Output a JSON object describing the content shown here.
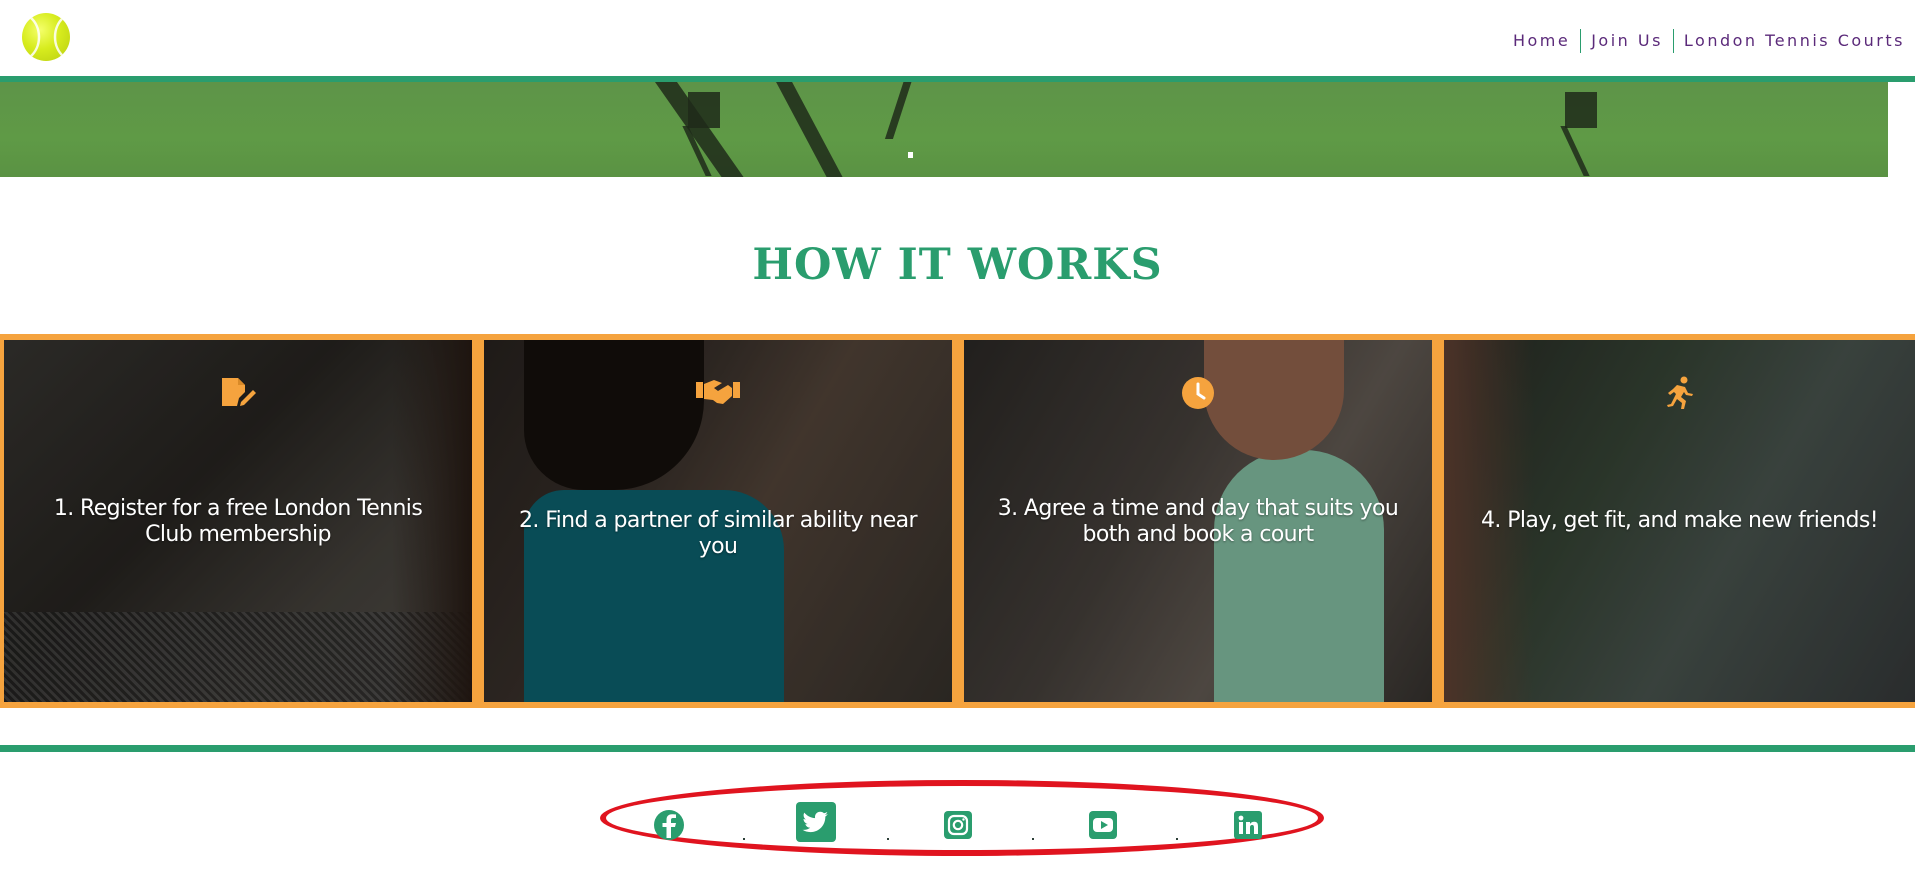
{
  "header": {
    "logo": "tennis-ball-logo",
    "nav": [
      {
        "label": "Home"
      },
      {
        "label": "Join Us"
      },
      {
        "label": "London Tennis Courts"
      }
    ]
  },
  "section": {
    "title": "HOW IT WORKS"
  },
  "steps": [
    {
      "icon": "file-signature-icon",
      "text": "1. Register for a free London Tennis Club membership"
    },
    {
      "icon": "handshake-icon",
      "text": "2. Find a partner of similar ability near you"
    },
    {
      "icon": "clock-icon",
      "text": "3. Agree a time and day that suits you both and book a court"
    },
    {
      "icon": "running-icon",
      "text": "4. Play, get fit, and make new friends!"
    }
  ],
  "social": [
    {
      "icon": "facebook-icon"
    },
    {
      "icon": "twitter-icon"
    },
    {
      "icon": "instagram-icon"
    },
    {
      "icon": "youtube-icon"
    },
    {
      "icon": "linkedin-icon"
    }
  ],
  "colors": {
    "brand_green": "#2a9d6e",
    "accent_orange": "#f5a33e",
    "nav_purple": "#5b2a7a",
    "highlight_red": "#e0141f"
  }
}
